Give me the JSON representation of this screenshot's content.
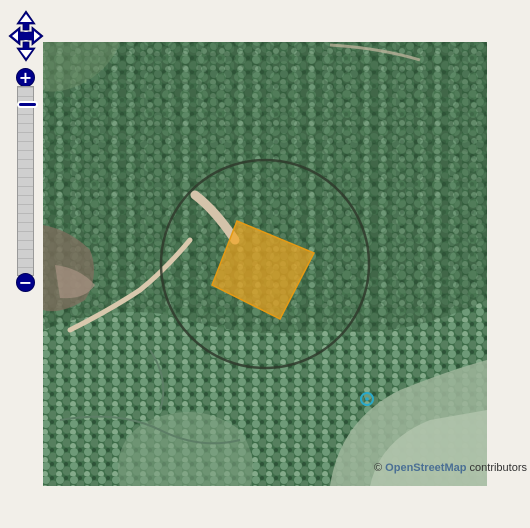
{
  "map": {
    "layer": "aerial imagery",
    "controls": {
      "zoom_in_label": "+",
      "zoom_out_label": "−",
      "zoom_level_fraction": 0.08
    },
    "overlays": {
      "search_radius_circle_color": "#2f3a2c",
      "area_polygon_fill": "#f2a51e",
      "area_polygon_stroke": "#e59a14",
      "poi_marker_color": "#2aa8c8"
    }
  },
  "attribution": {
    "prefix": "© ",
    "link_text": "OpenStreetMap",
    "suffix": " contributors"
  },
  "colors": {
    "page_background": "#f2efe9",
    "control_blue": "#00008b",
    "link_color": "#4a6f94"
  }
}
